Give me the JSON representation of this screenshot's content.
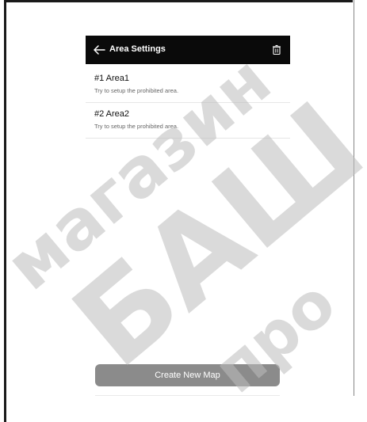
{
  "header": {
    "title": "Area Settings"
  },
  "icons": {
    "back": "arrow-left-icon",
    "delete": "trash-icon"
  },
  "areas": [
    {
      "name": "#1 Area1",
      "desc": "Try to setup the prohibited area."
    },
    {
      "name": "#2 Area2",
      "desc": "Try to setup the prohibited area."
    }
  ],
  "actions": {
    "create_label": "Create New Map"
  },
  "watermark": {
    "line1": "магазин",
    "line2": "БАШ",
    "line3": "про"
  },
  "colors": {
    "topbar": "#0a0a0a",
    "button": "#8b8b8b"
  }
}
